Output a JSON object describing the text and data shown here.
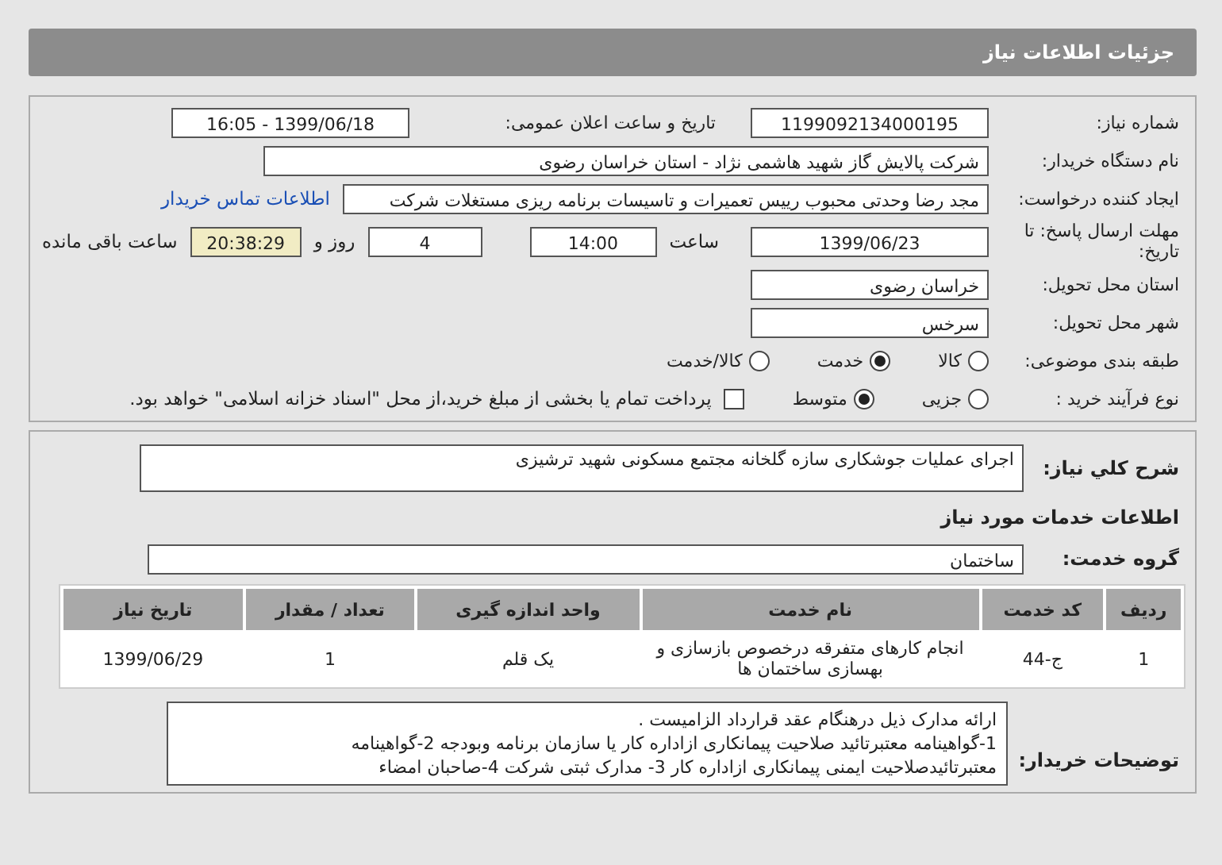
{
  "header": {
    "title": "جزئیات اطلاعات نیاز"
  },
  "details": {
    "need_number": {
      "label": "شماره نیاز:",
      "value": "1199092134000195"
    },
    "announce": {
      "label": "تاریخ و ساعت اعلان عمومی:",
      "value": "1399/06/18 - 16:05"
    },
    "buyer": {
      "label": "نام دستگاه خریدار:",
      "value": "شرکت پالایش گاز شهید هاشمی نژاد - استان خراسان رضوی"
    },
    "creator": {
      "label": "ایجاد کننده درخواست:",
      "value": "مجد رضا وحدتی محبوب رییس تعمیرات و تاسیسات برنامه ریزی مستغلات شرکت",
      "link": "اطلاعات تماس خریدار"
    },
    "deadline": {
      "label": "مهلت ارسال پاسخ: تا تاریخ:",
      "date": "1399/06/23",
      "time_label": "ساعت",
      "time": "14:00",
      "days": "4",
      "days_label": "روز و",
      "remaining": "20:38:29",
      "remaining_label": "ساعت باقی مانده"
    },
    "province": {
      "label": "استان محل تحویل:",
      "value": "خراسان رضوی"
    },
    "city": {
      "label": "شهر محل تحویل:",
      "value": "سرخس"
    },
    "category": {
      "label": "طبقه بندی موضوعی:",
      "options": [
        {
          "label": "کالا",
          "selected": false
        },
        {
          "label": "خدمت",
          "selected": true
        },
        {
          "label": "کالا/خدمت",
          "selected": false
        }
      ]
    },
    "process": {
      "label": "نوع فرآیند خرید :",
      "options": [
        {
          "label": "جزیی",
          "selected": false
        },
        {
          "label": "متوسط",
          "selected": true
        }
      ],
      "payment": {
        "label": "پرداخت تمام یا بخشی از مبلغ خرید،از محل \"اسناد خزانه اسلامی\" خواهد بود.",
        "checked": false
      }
    }
  },
  "summary": {
    "label": "شرح کلي نياز:",
    "value": "اجرای عملیات جوشکاری سازه گلخانه مجتمع مسکونی شهید ترشیزی"
  },
  "services_heading": "اطلاعات خدمات مورد نیاز",
  "service_group": {
    "label": "گروه خدمت:",
    "value": "ساختمان"
  },
  "table": {
    "columns": [
      "ردیف",
      "کد خدمت",
      "نام خدمت",
      "واحد اندازه گیری",
      "تعداد / مقدار",
      "تاریخ نیاز"
    ],
    "rows": [
      [
        "1",
        "ج-44",
        "انجام کارهای متفرقه درخصوص بازسازی و بهسازی ساختمان ها",
        "یک قلم",
        "1",
        "1399/06/29"
      ]
    ]
  },
  "notes": {
    "label": "توضیحات خریدار:",
    "lines": [
      "ارائه مدارک ذیل درهنگام عقد قرارداد الزامیست .",
      "1-گواهینامه معتبرتائید صلاحیت پیمانکاری ازاداره کار یا سازمان برنامه وبودجه 2-گواهینامه",
      "معتبرتائیدصلاحیت ایمنی پیمانکاری ازاداره کار 3- مدارک ثبتی شرکت 4-صاحبان امضاء"
    ]
  }
}
